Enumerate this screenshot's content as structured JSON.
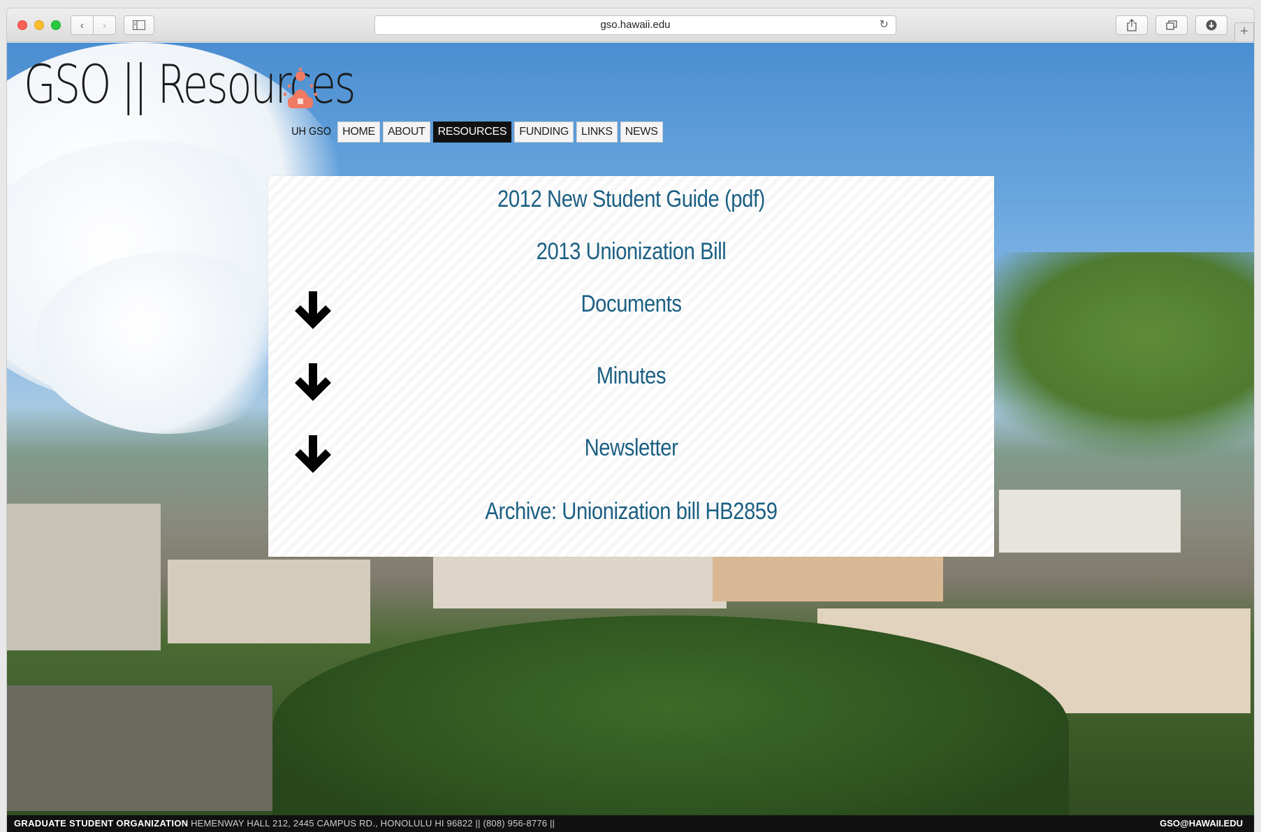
{
  "browser": {
    "url": "gso.hawaii.edu",
    "back_icon": "‹",
    "forward_icon": "›",
    "reload_icon": "↻",
    "new_tab_icon": "+"
  },
  "logo": {
    "text": "GSO || Resources"
  },
  "nav": {
    "brand": "UH GSO",
    "items": [
      "HOME",
      "ABOUT",
      "RESOURCES",
      "FUNDING",
      "LINKS",
      "NEWS"
    ],
    "active": "RESOURCES"
  },
  "resources": {
    "guide": "2012 New Student Guide (pdf)",
    "bill": "2013 Unionization Bill",
    "documents": "Documents",
    "minutes": "Minutes",
    "newsletter": "Newsletter",
    "archive": "Archive: Unionization bill HB2859"
  },
  "footer": {
    "org": "GRADUATE STUDENT ORGANIZATION",
    "address": "HEMENWAY HALL 212, 2445 CAMPUS RD., HONOLULU HI 96822 || (808) 956-8776 ||",
    "email": "GSO@HAWAII.EDU"
  },
  "colors": {
    "link": "#1b5f83",
    "nav_active": "#111111",
    "logo_mark": "#f07a63"
  }
}
